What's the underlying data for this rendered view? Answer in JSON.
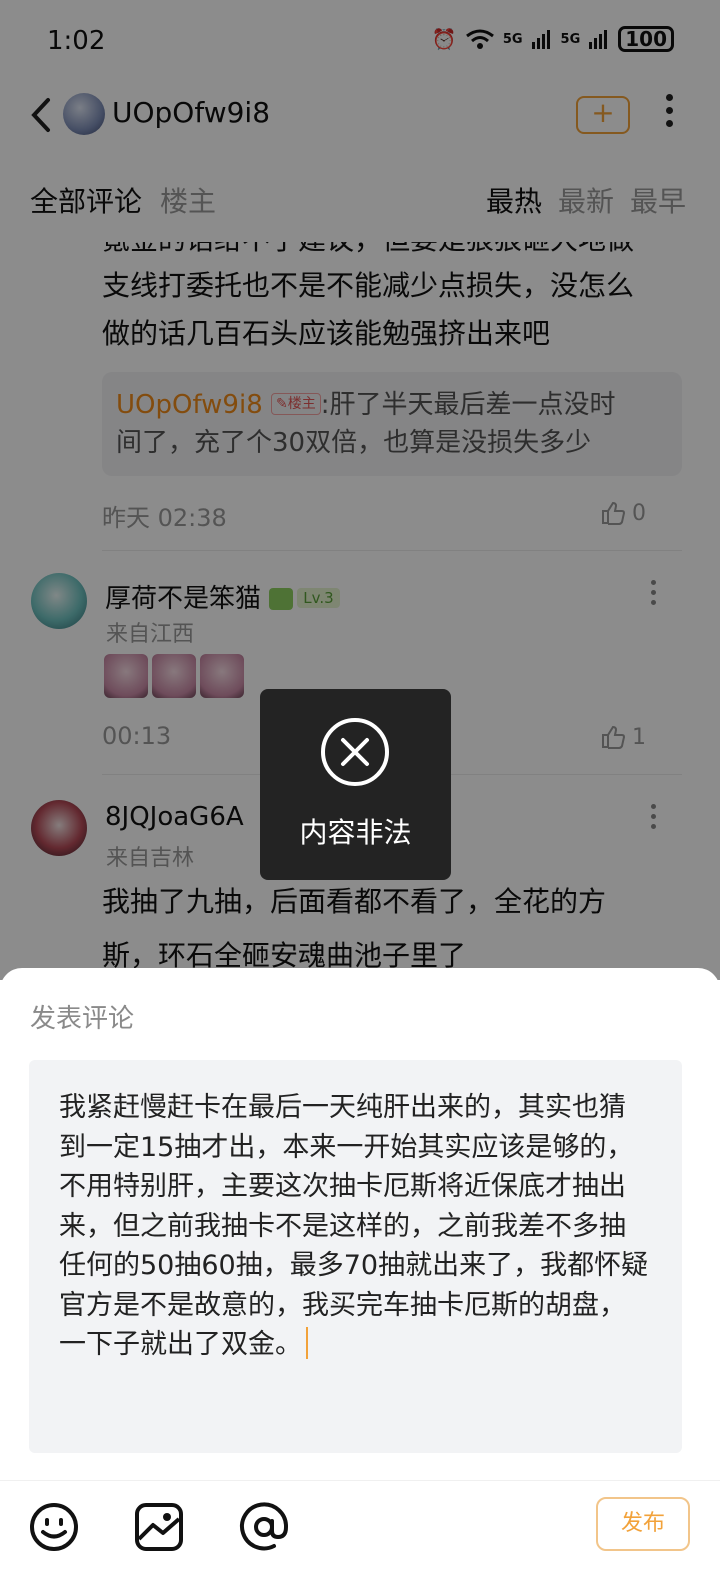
{
  "status_bar": {
    "time": "1:02",
    "signal_1": "5G",
    "signal_2": "5G",
    "battery": "100"
  },
  "header": {
    "username": "UOpOfw9i8",
    "plus_label": "+",
    "accent_color": "#f2a23a"
  },
  "tabs": {
    "all": "全部评论",
    "owner": "楼主",
    "hot": "最热",
    "newest": "最新",
    "oldest": "最早"
  },
  "comments": {
    "first": {
      "line_partial": "氪金的话给不了建议，但要是狠狠砸大地做",
      "line_2": "支线打委托也不是不能减少点损失，没怎么",
      "line_3": "做的话几百石头应该能勉强挤出来吧",
      "quote_name": "UOpOfw9i8",
      "quote_badge": "楼主",
      "quote_text_1": ":肝了半天最后差一点没时",
      "quote_text_2": "间了，充了个30双倍，也算是没损失多少",
      "time": "昨天 02:38",
      "likes": "0"
    },
    "second": {
      "username": "厚荷不是笨猫",
      "level": "Lv.3",
      "location": "来自江西",
      "time": "00:13",
      "likes": "1"
    },
    "third": {
      "username": "8JQJoaG6A",
      "location": "来自吉林",
      "line_1": "我抽了九抽，后面看都不看了，全花的方",
      "line_2": "斯，环石全砸安魂曲池子里了"
    }
  },
  "toast": {
    "message": "内容非法",
    "icon": "close-circle-icon"
  },
  "composer": {
    "title": "发表评论",
    "text": "我紧赶慢赶卡在最后一天纯肝出来的，其实也猜到一定15抽才出，本来一开始其实应该是够的，不用特别肝，主要这次抽卡厄斯将近保底才抽出来，但之前我抽卡不是这样的，之前我差不多抽任何的50抽60抽，最多70抽就出来了，我都怀疑官方是不是故意的，我买完车抽卡厄斯的胡盘，一下子就出了双金。",
    "tools": [
      "emoji-icon",
      "image-icon",
      "at-icon"
    ],
    "publish_label": "发布"
  }
}
